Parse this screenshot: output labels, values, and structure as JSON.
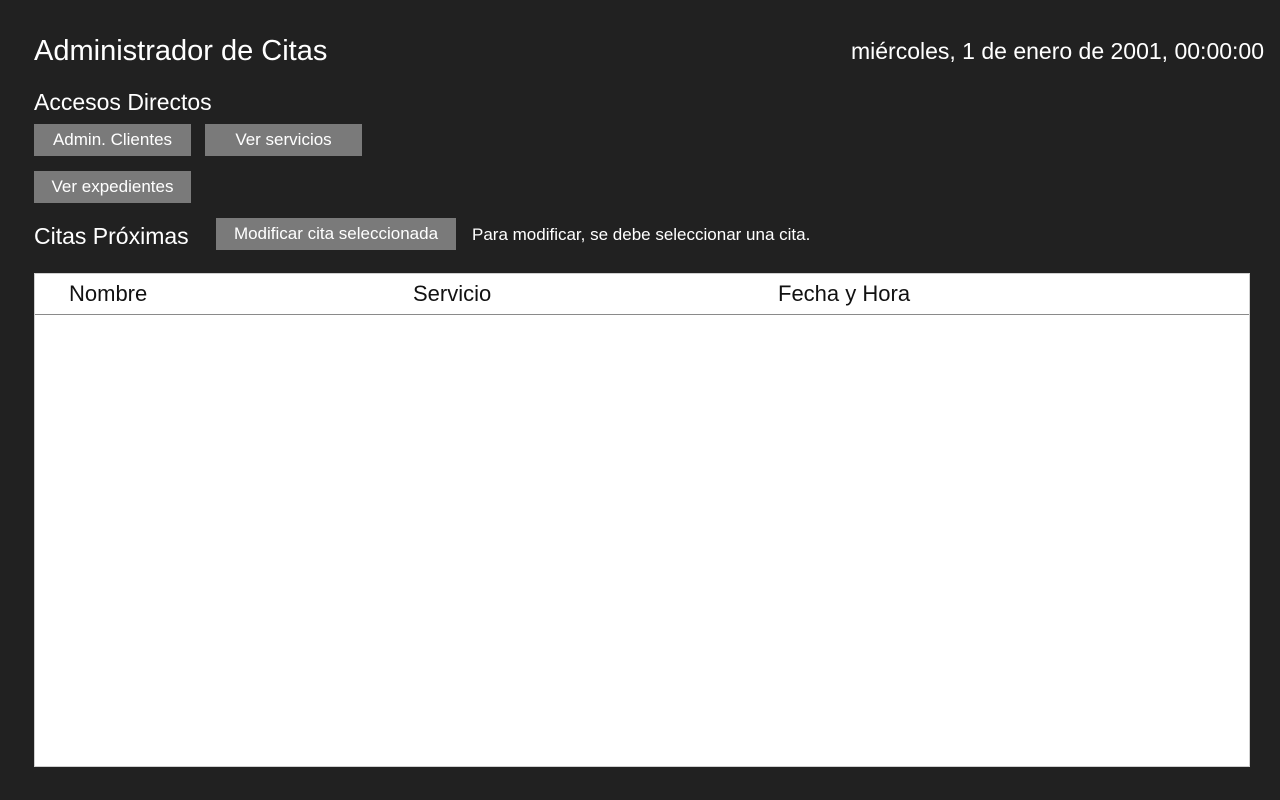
{
  "header": {
    "title": "Administrador de Citas",
    "clock": "miércoles, 1 de enero de 2001, 00:00:00"
  },
  "shortcuts": {
    "heading": "Accesos Directos",
    "buttons": {
      "clients": "Admin. Clientes",
      "services": "Ver servicios",
      "records": "Ver expedientes"
    }
  },
  "upcoming": {
    "heading": "Citas Próximas",
    "modify_button": "Modificar cita seleccionada",
    "hint": "Para modificar, se debe seleccionar una cita.",
    "table": {
      "columns": [
        "Nombre",
        "Servicio",
        "Fecha y Hora"
      ],
      "rows": []
    }
  },
  "colors": {
    "background": "#212121",
    "button": "#7a7a7a",
    "table_background": "#ffffff"
  }
}
